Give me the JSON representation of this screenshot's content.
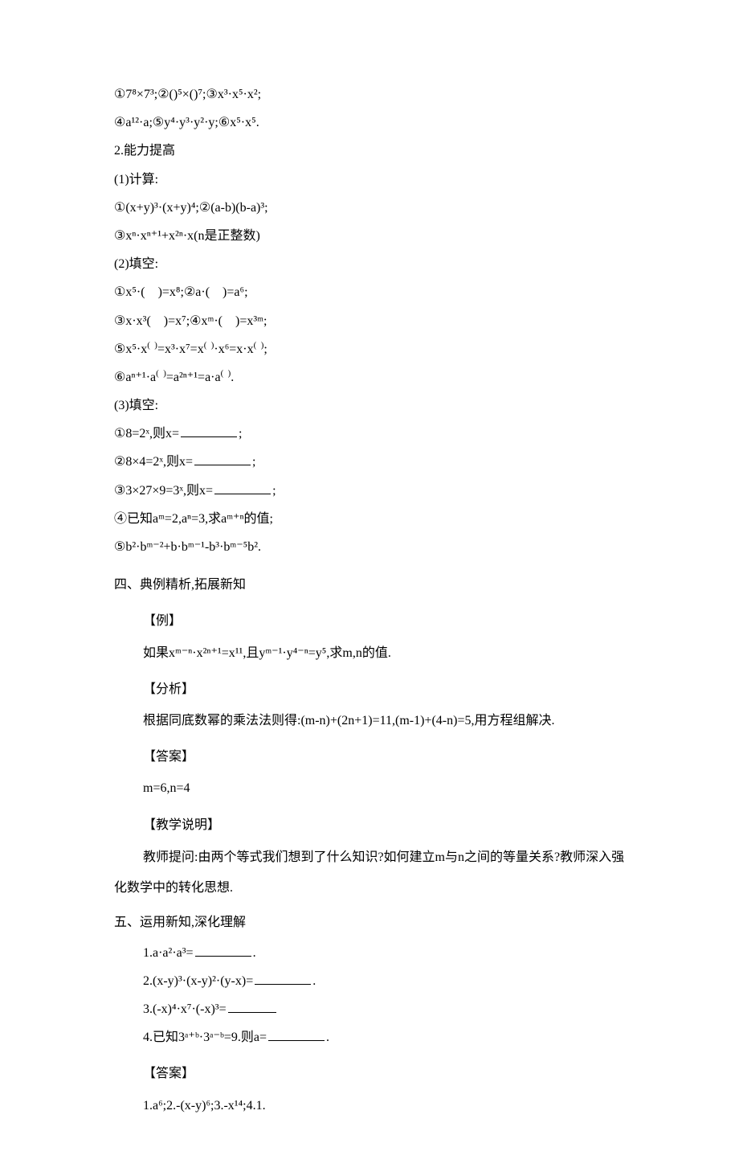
{
  "block1": {
    "l1": "①7⁸×7³;②()⁵×()⁷;③x³·x⁵·x²;",
    "l2": "④a¹²·a;⑤y⁴·y³·y²·y;⑥x⁵·x⁵.",
    "l3": "2.能力提高",
    "l4": "(1)计算:",
    "l5": "①(x+y)³·(x+y)⁴;②(a-b)(b-a)³;",
    "l6": "③xⁿ·xⁿ⁺¹+x²ⁿ·x(n是正整数)",
    "l7": "(2)填空:",
    "l8": "①x⁵·( )=x⁸;②a·( )=a⁶;",
    "l9": "③x·x³( )=x⁷;④xᵐ·( )=x³ᵐ;",
    "l10_a": "⑤x⁵·x",
    "l10_b": "=x³·x⁷=x",
    "l10_c": "·x⁶=x·x",
    "l10_d": ";",
    "l11_a": "⑥aⁿ⁺¹·a",
    "l11_b": "=a²ⁿ⁺¹=a·a",
    "l11_c": ".",
    "l12": "(3)填空:",
    "l13_a": "①8=2ˣ,则x=",
    "l13_b": ";",
    "l14_a": "②8×4=2ˣ,则x=",
    "l14_b": ";",
    "l15_a": "③3×27×9=3ˣ,则x=",
    "l15_b": ";",
    "l16": "④已知aᵐ=2,aⁿ=3,求aᵐ⁺ⁿ的值;",
    "l17": "⑤b²·bᵐ⁻²+b·bᵐ⁻¹-b³·bᵐ⁻⁵b²."
  },
  "sec4_title": "四、典例精析,拓展新知",
  "ex_label": "【例】",
  "ex_body": "如果xᵐ⁻ⁿ·x²ⁿ⁺¹=x¹¹,且yᵐ⁻¹·y⁴⁻ⁿ=y⁵,求m,n的值.",
  "an_label": "【分析】",
  "an_body": "根据同底数幂的乘法法则得:(m-n)+(2n+1)=11,(m-1)+(4-n)=5,用方程组解决.",
  "ans_label": "【答案】",
  "ans_body": "m=6,n=4",
  "note_label": "【教学说明】",
  "note_body": "教师提问:由两个等式我们想到了什么知识?如何建立m与n之间的等量关系?教师深入强化数学中的转化思想.",
  "sec5_title": "五、运用新知,深化理解",
  "q1_a": "1.a·a²·a³=",
  "q1_b": ".",
  "q2_a": "2.(x-y)³·(x-y)²·(y-x)=",
  "q2_b": ".",
  "q3_a": "3.(-x)⁴·x⁷·(-x)³=",
  "q4_a": "4.已知3ᵃ⁺ᵇ·3ᵃ⁻ᵇ=9.则a=",
  "q4_b": ".",
  "ans2_label": "【答案】",
  "ans2_body": "1.a⁶;2.-(x-y)⁶;3.-x¹⁴;4.1."
}
